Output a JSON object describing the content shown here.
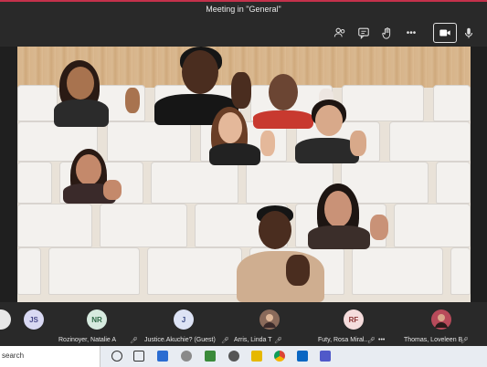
{
  "window": {
    "title": "Meeting in \"General\""
  },
  "toolbar": {
    "buttons": [
      {
        "name": "participants-icon"
      },
      {
        "name": "chat-icon"
      },
      {
        "name": "raise-hand-icon"
      },
      {
        "name": "more-options-icon",
        "glyph": "•••"
      },
      {
        "name": "camera-icon"
      },
      {
        "name": "microphone-icon"
      }
    ]
  },
  "participants": [
    {
      "initials": "JS",
      "name": "",
      "avatar_color": "#d9d9f3",
      "text_color": "#4a4a8a"
    },
    {
      "initials": "NR",
      "name": "Rozinoyer, Natalie A",
      "avatar_color": "#d6eadf",
      "text_color": "#2f6a47"
    },
    {
      "initials": "J",
      "name": "Justice.Akuchie? (Guest)",
      "avatar_color": "#dde3f5",
      "text_color": "#3b4c86"
    },
    {
      "initials": "",
      "name": "Arris, Linda T",
      "avatar_color": "#8a6a5a",
      "text_color": "#ffffff"
    },
    {
      "initials": "RF",
      "name": "Futy, Rosa Miral...",
      "avatar_color": "#f5dcdc",
      "text_color": "#8a3232"
    },
    {
      "initials": "",
      "name": "Thomas, Loveleen B",
      "avatar_color": "#b84a5a",
      "text_color": "#ffffff"
    }
  ],
  "tile_more": "•••",
  "taskbar": {
    "search_text": "search"
  },
  "colors": {
    "accent_red": "#c4314b",
    "bar": "#292929",
    "stage": "#1f1f1f"
  }
}
